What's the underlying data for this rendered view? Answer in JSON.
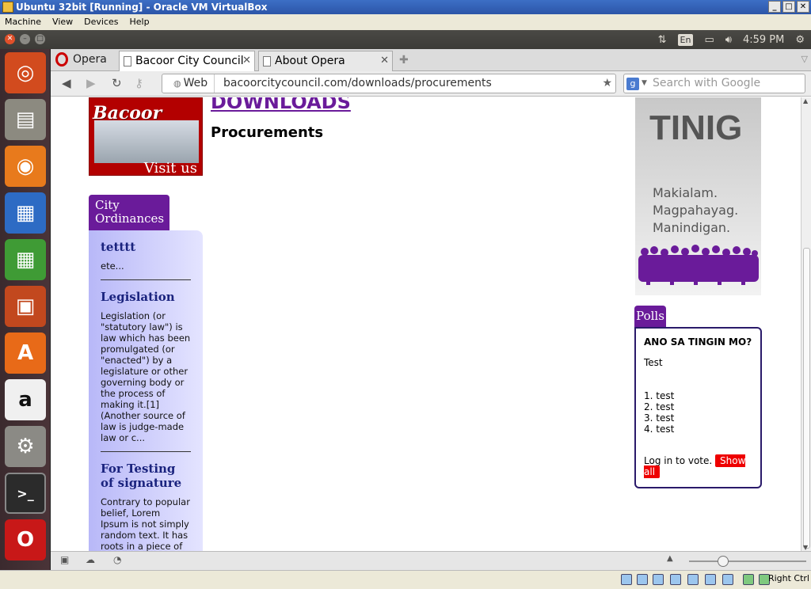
{
  "vbox": {
    "title": "Ubuntu 32bit [Running] - Oracle VM VirtualBox",
    "menu": [
      "Machine",
      "View",
      "Devices",
      "Help"
    ],
    "host_key": "Right Ctrl"
  },
  "panel": {
    "lang": "En",
    "time": "4:59 PM"
  },
  "launcher": {
    "items": [
      "ubuntu-dash",
      "files",
      "firefox",
      "writer",
      "calc",
      "impress",
      "software-center",
      "amazon",
      "system-settings",
      "terminal",
      "opera"
    ]
  },
  "browser": {
    "menu_label": "Opera",
    "tabs": [
      {
        "label": "Bacoor City Council",
        "active": true
      },
      {
        "label": "About Opera",
        "active": false
      }
    ],
    "address": {
      "badge": "Web",
      "url": "bacoorcitycouncil.com/downloads/procurements"
    },
    "search_placeholder": "Search with Google"
  },
  "page": {
    "logo": {
      "brand": "Bacoor",
      "visit": "Visit us"
    },
    "heading": "DOWNLOADS",
    "subheading": "Procurements",
    "ordinances": {
      "tab_label": "City Ordinances",
      "items": [
        {
          "title": "tetttt",
          "text": "ete..."
        },
        {
          "title": "Legislation",
          "text": "Legislation (or \"statutory law\") is law which has been promulgated (or \"enacted\") by a legislature or other governing body or the process of making it.[1] (Another source of law is judge-made law or c..."
        },
        {
          "title": "For Testing of signature",
          "text": "Contrary to popular belief, Lorem Ipsum is not simply random text. It has roots in a piece of classical"
        }
      ]
    },
    "banner": {
      "word": "TINIG",
      "lines": [
        "Makialam.",
        "Magpahayag.",
        "Manindigan."
      ]
    },
    "polls": {
      "tab_label": "Polls",
      "question": "ANO SA TINGIN MO?",
      "description": "Test",
      "options": [
        "1. test",
        "2. test",
        "3. test",
        "4. test"
      ],
      "login_text": "Log in to vote.",
      "show_all": "Show all"
    }
  },
  "colors": {
    "accent_purple": "#6a1b9a",
    "poll_button": "#ee0000",
    "titlebar": "#3c6fc5"
  }
}
